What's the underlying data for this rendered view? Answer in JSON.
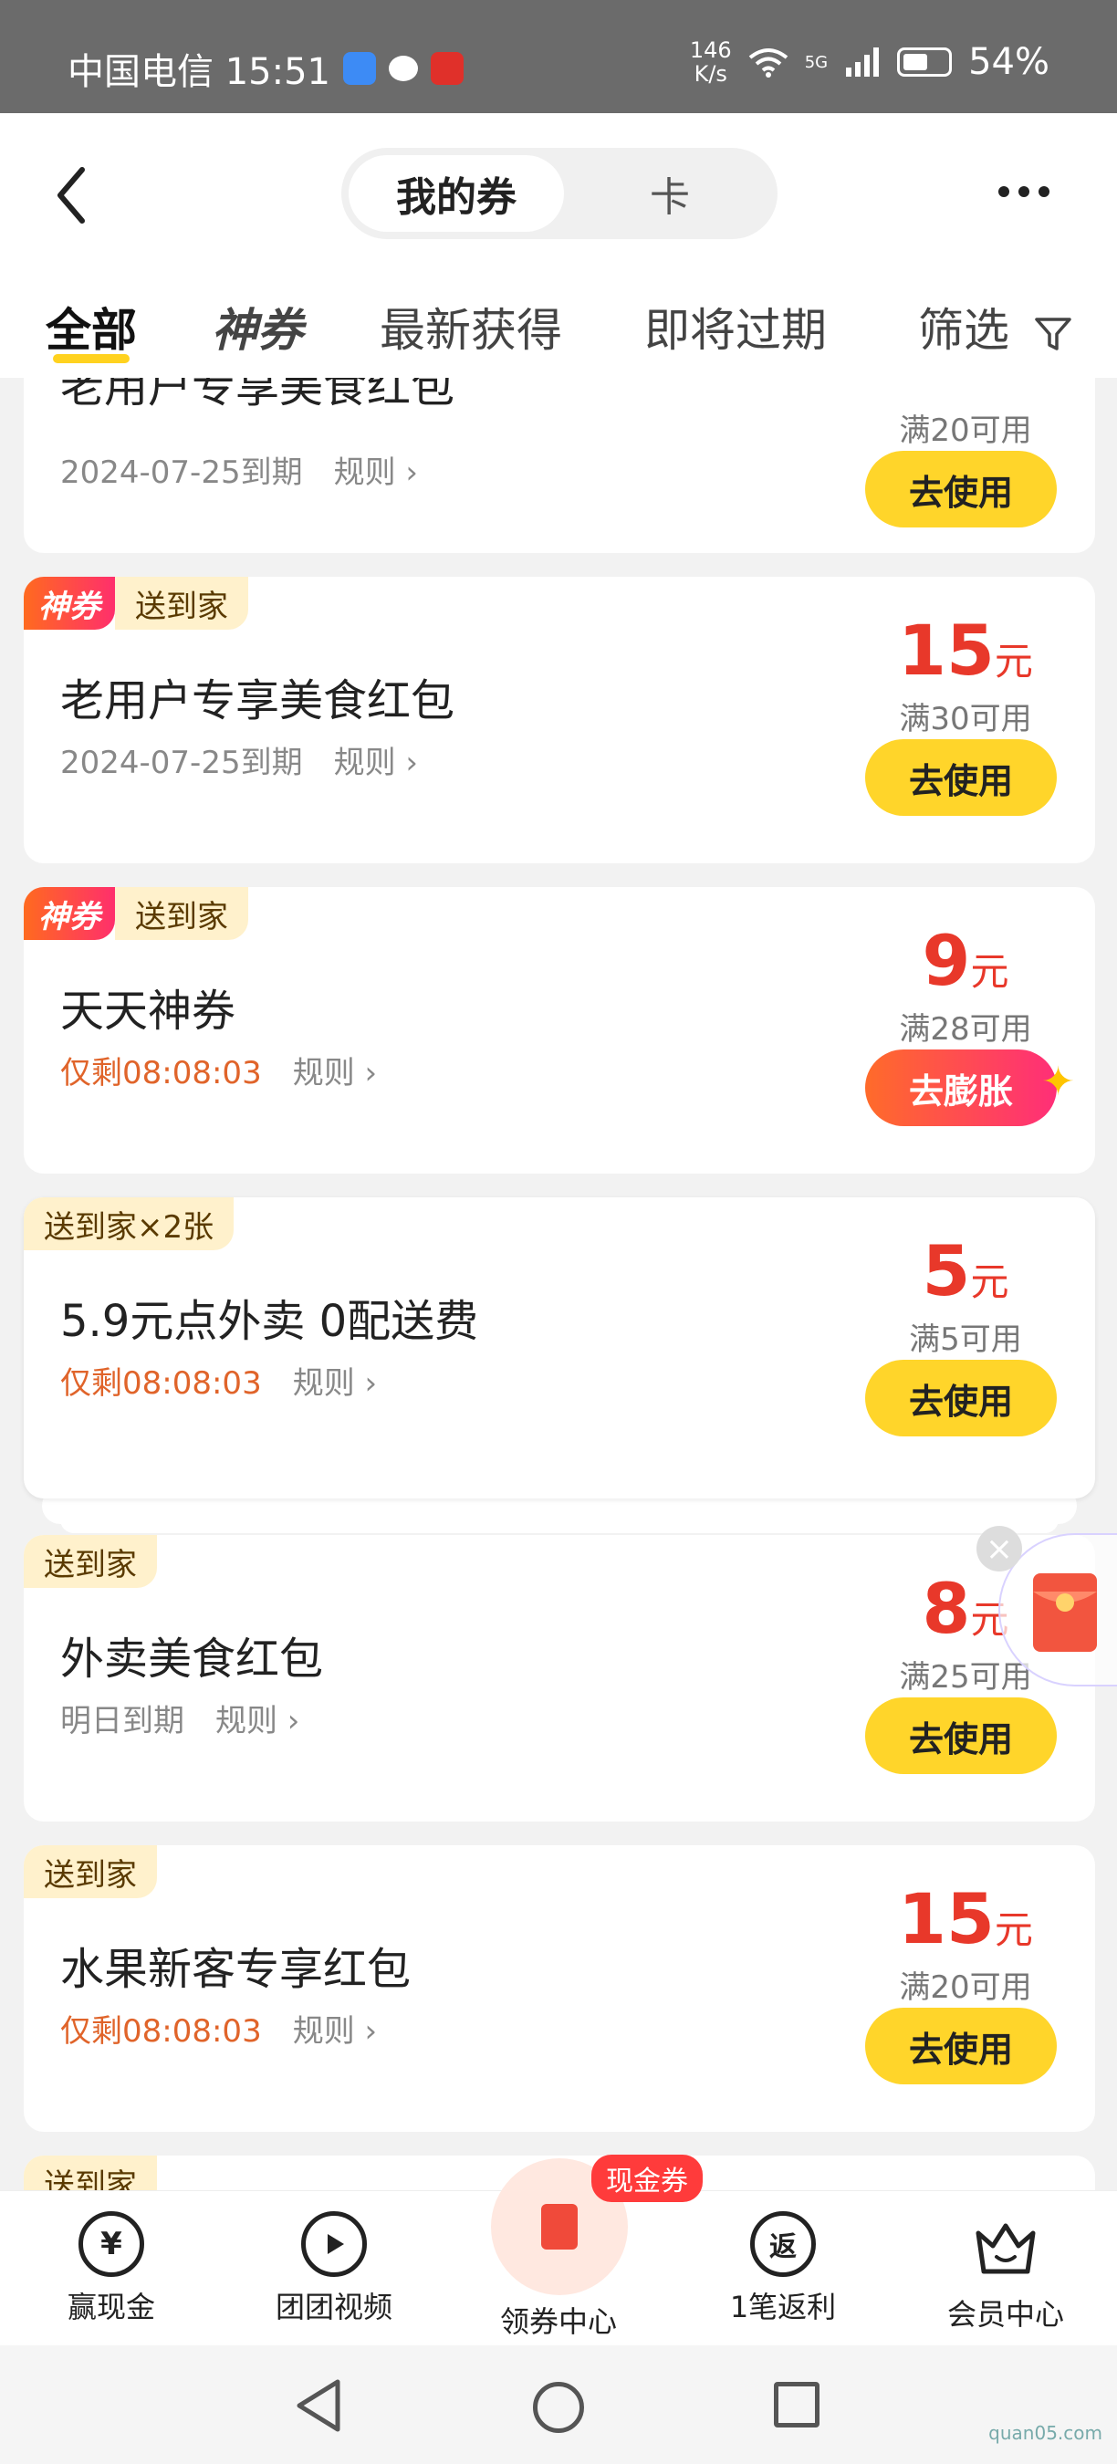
{
  "status_bar": {
    "carrier_time": "中国电信 15:51",
    "net_speed_value": "146",
    "net_speed_unit": "K/s",
    "battery": "54%",
    "signal": "5G"
  },
  "header": {
    "seg_active": "我的券",
    "seg_inactive": "卡"
  },
  "tabs": {
    "all": "全部",
    "shenquan": "神券",
    "newest": "最新获得",
    "expiring": "即将过期",
    "filter": "筛选"
  },
  "cards": [
    {
      "title": "老用户专享美食红包",
      "expire": "2024-07-25到期",
      "rule": "规则",
      "cond": "满20可用",
      "btn": "去使用"
    },
    {
      "badge_shen": "神券",
      "badge_home": "送到家",
      "title": "老用户专享美食红包",
      "expire": "2024-07-25到期",
      "rule": "规则",
      "amount": "15",
      "unit": "元",
      "cond": "满30可用",
      "btn": "去使用"
    },
    {
      "badge_shen": "神券",
      "badge_home": "送到家",
      "title": "天天神券",
      "expire": "仅剩08:08:03",
      "rule": "规则",
      "amount": "9",
      "unit": "元",
      "cond": "满28可用",
      "btn": "去膨胀"
    },
    {
      "badge_home": "送到家×2张",
      "title": "5.9元点外卖 0配送费",
      "expire": "仅剩08:08:03",
      "rule": "规则",
      "amount": "5",
      "unit": "元",
      "cond": "满5可用",
      "btn": "去使用"
    },
    {
      "badge_home": "送到家",
      "title": "外卖美食红包",
      "expire": "明日到期",
      "rule": "规则",
      "amount": "8",
      "unit": "元",
      "cond": "满25可用",
      "btn": "去使用"
    },
    {
      "badge_home": "送到家",
      "title": "水果新客专享红包",
      "expire": "仅剩08:08:03",
      "rule": "规则",
      "amount": "15",
      "unit": "元",
      "cond": "满20可用",
      "btn": "去使用"
    },
    {
      "badge_home": "送到家"
    }
  ],
  "bottom_nav": {
    "earn_cash": "赢现金",
    "group_video": "团团视频",
    "coupon_center": "领券中心",
    "cash_badge": "现金券",
    "rebate": "1笔返利",
    "rebate_icon": "返",
    "member": "会员中心",
    "earn_icon": "¥"
  },
  "watermark": "quan05.com",
  "colors": {
    "accent_yellow": "#ffd52a",
    "price_red": "#e8382a",
    "countdown_orange": "#e0642a"
  }
}
